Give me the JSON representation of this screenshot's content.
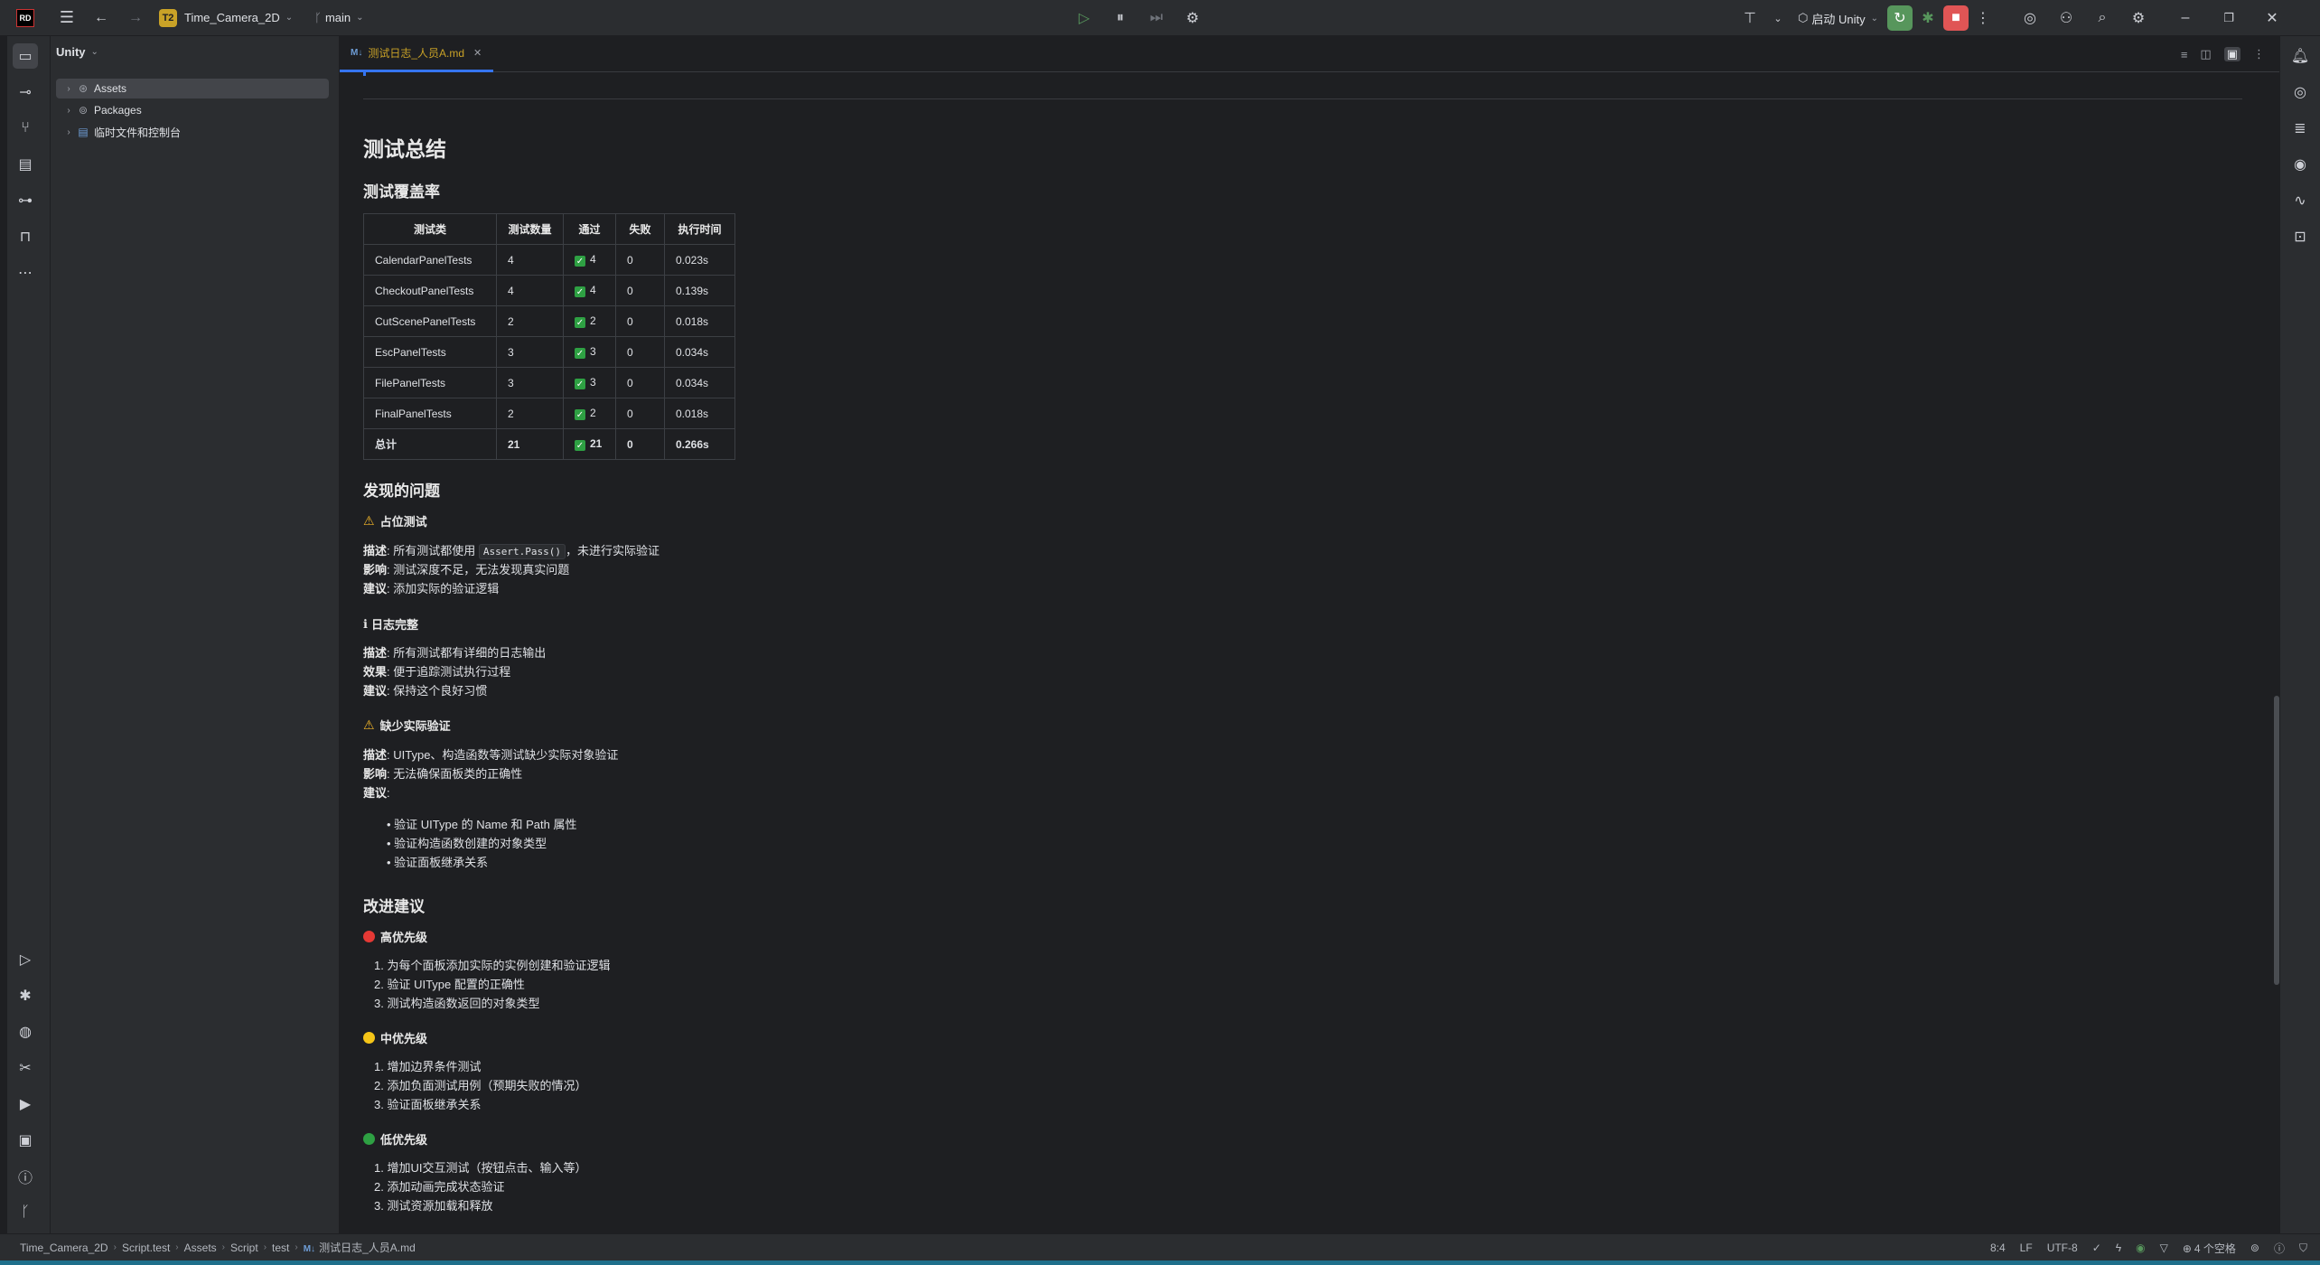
{
  "titlebar": {
    "project_badge": "T2",
    "project_name": "Time_Camera_2D",
    "branch": "main",
    "run_config": "启动 Unity"
  },
  "project_panel": {
    "title": "Unity",
    "items": [
      {
        "label": "Assets"
      },
      {
        "label": "Packages"
      },
      {
        "label": "临时文件和控制台"
      }
    ]
  },
  "tab": {
    "badge": "M↓",
    "label": "测试日志_人员A.md"
  },
  "doc": {
    "h_summary": "测试总结",
    "h_coverage": "测试覆盖率",
    "table": {
      "headers": [
        "测试类",
        "测试数量",
        "通过",
        "失败",
        "执行时间"
      ],
      "rows": [
        [
          "CalendarPanelTests",
          "4",
          "4",
          "0",
          "0.023s"
        ],
        [
          "CheckoutPanelTests",
          "4",
          "4",
          "0",
          "0.139s"
        ],
        [
          "CutScenePanelTests",
          "2",
          "2",
          "0",
          "0.018s"
        ],
        [
          "EscPanelTests",
          "3",
          "3",
          "0",
          "0.034s"
        ],
        [
          "FilePanelTests",
          "3",
          "3",
          "0",
          "0.034s"
        ],
        [
          "FinalPanelTests",
          "2",
          "2",
          "0",
          "0.018s"
        ]
      ],
      "total": [
        "总计",
        "21",
        "21",
        "0",
        "0.266s"
      ]
    },
    "h_issues": "发现的问题",
    "issue1": {
      "title": "占位测试",
      "desc_label": "描述",
      "desc_pre": ": 所有测试都使用 ",
      "desc_code": "Assert.Pass()",
      "desc_post": "，未进行实际验证",
      "impact_label": "影响",
      "impact": ": 测试深度不足，无法发现真实问题",
      "suggest_label": "建议",
      "suggest": ": 添加实际的验证逻辑"
    },
    "issue2": {
      "icon": "ℹ",
      "title": "日志完整",
      "desc_label": "描述",
      "desc": ": 所有测试都有详细的日志输出",
      "effect_label": "效果",
      "effect": ": 便于追踪测试执行过程",
      "suggest_label": "建议",
      "suggest": ": 保持这个良好习惯"
    },
    "issue3": {
      "title": "缺少实际验证",
      "desc_label": "描述",
      "desc": ": UIType、构造函数等测试缺少实际对象验证",
      "impact_label": "影响",
      "impact": ": 无法确保面板类的正确性",
      "suggest_label": "建议",
      "suggest": ":",
      "bullets": [
        "验证 UIType 的 Name 和 Path 属性",
        "验证构造函数创建的对象类型",
        "验证面板继承关系"
      ]
    },
    "h_improve": "改进建议",
    "high": {
      "title": "高优先级",
      "items": [
        "1. 为每个面板添加实际的实例创建和验证逻辑",
        "2. 验证 UIType 配置的正确性",
        "3. 测试构造函数返回的对象类型"
      ]
    },
    "mid": {
      "title": "中优先级",
      "items": [
        "1. 增加边界条件测试",
        "2. 添加负面测试用例（预期失败的情况）",
        "3. 验证面板继承关系"
      ]
    },
    "low": {
      "title": "低优先级",
      "items": [
        "1. 增加UI交互测试（按钮点击、输入等）",
        "2. 添加动画完成状态验证",
        "3. 测试资源加载和释放"
      ]
    },
    "colors": {
      "high": "#e53935",
      "mid": "#f5c518",
      "low": "#2ea043",
      "warn": "#f0b429"
    }
  },
  "statusbar": {
    "breadcrumb": [
      "Time_Camera_2D",
      "Script.test",
      "Assets",
      "Script",
      "test"
    ],
    "file_badge": "M↓",
    "file": "测试日志_人员A.md",
    "position": "8:4",
    "line_sep": "LF",
    "encoding": "UTF-8",
    "indent": "4 个空格"
  }
}
